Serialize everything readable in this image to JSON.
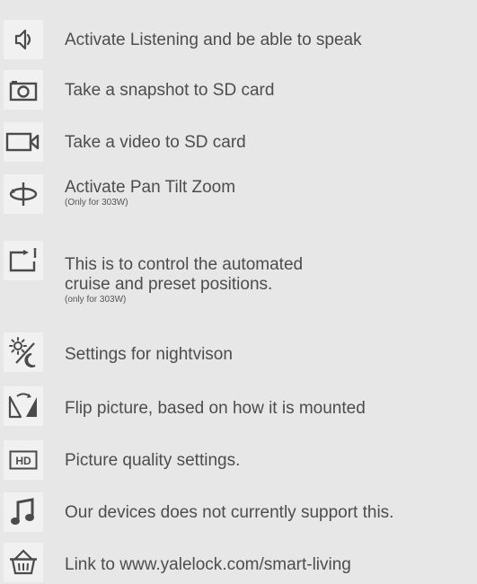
{
  "items": [
    {
      "icon": "speaker-icon",
      "label": "Activate Listening and be able to speak",
      "note": ""
    },
    {
      "icon": "camera-icon",
      "label": "Take a snapshot to SD card",
      "note": ""
    },
    {
      "icon": "video-camera-icon",
      "label": "Take a video to SD card",
      "note": ""
    },
    {
      "icon": "pan-tilt-zoom-icon",
      "label": "Activate Pan Tilt Zoom",
      "note": "(Only for 303W)"
    },
    {
      "icon": "cruise-icon",
      "label_line1": "This is to control the automated",
      "label_line2": "cruise and preset positions.",
      "note": "(only for 303W)"
    },
    {
      "icon": "nightvision-icon",
      "label": "Settings for nightvison",
      "note": ""
    },
    {
      "icon": "flip-icon",
      "label": "Flip picture, based on how it is mounted",
      "note": ""
    },
    {
      "icon": "hd-icon",
      "label": "Picture quality settings.",
      "note": ""
    },
    {
      "icon": "music-note-icon",
      "label": "Our devices does not currently support this.",
      "note": ""
    },
    {
      "icon": "basket-icon",
      "label": "Link to www.yalelock.com/smart-living",
      "note": ""
    }
  ],
  "colors": {
    "background": "#e7e7e7",
    "icon_tile": "#f1f1f1",
    "icon_stroke": "#4b4b4b",
    "text": "#4d4d4d"
  }
}
